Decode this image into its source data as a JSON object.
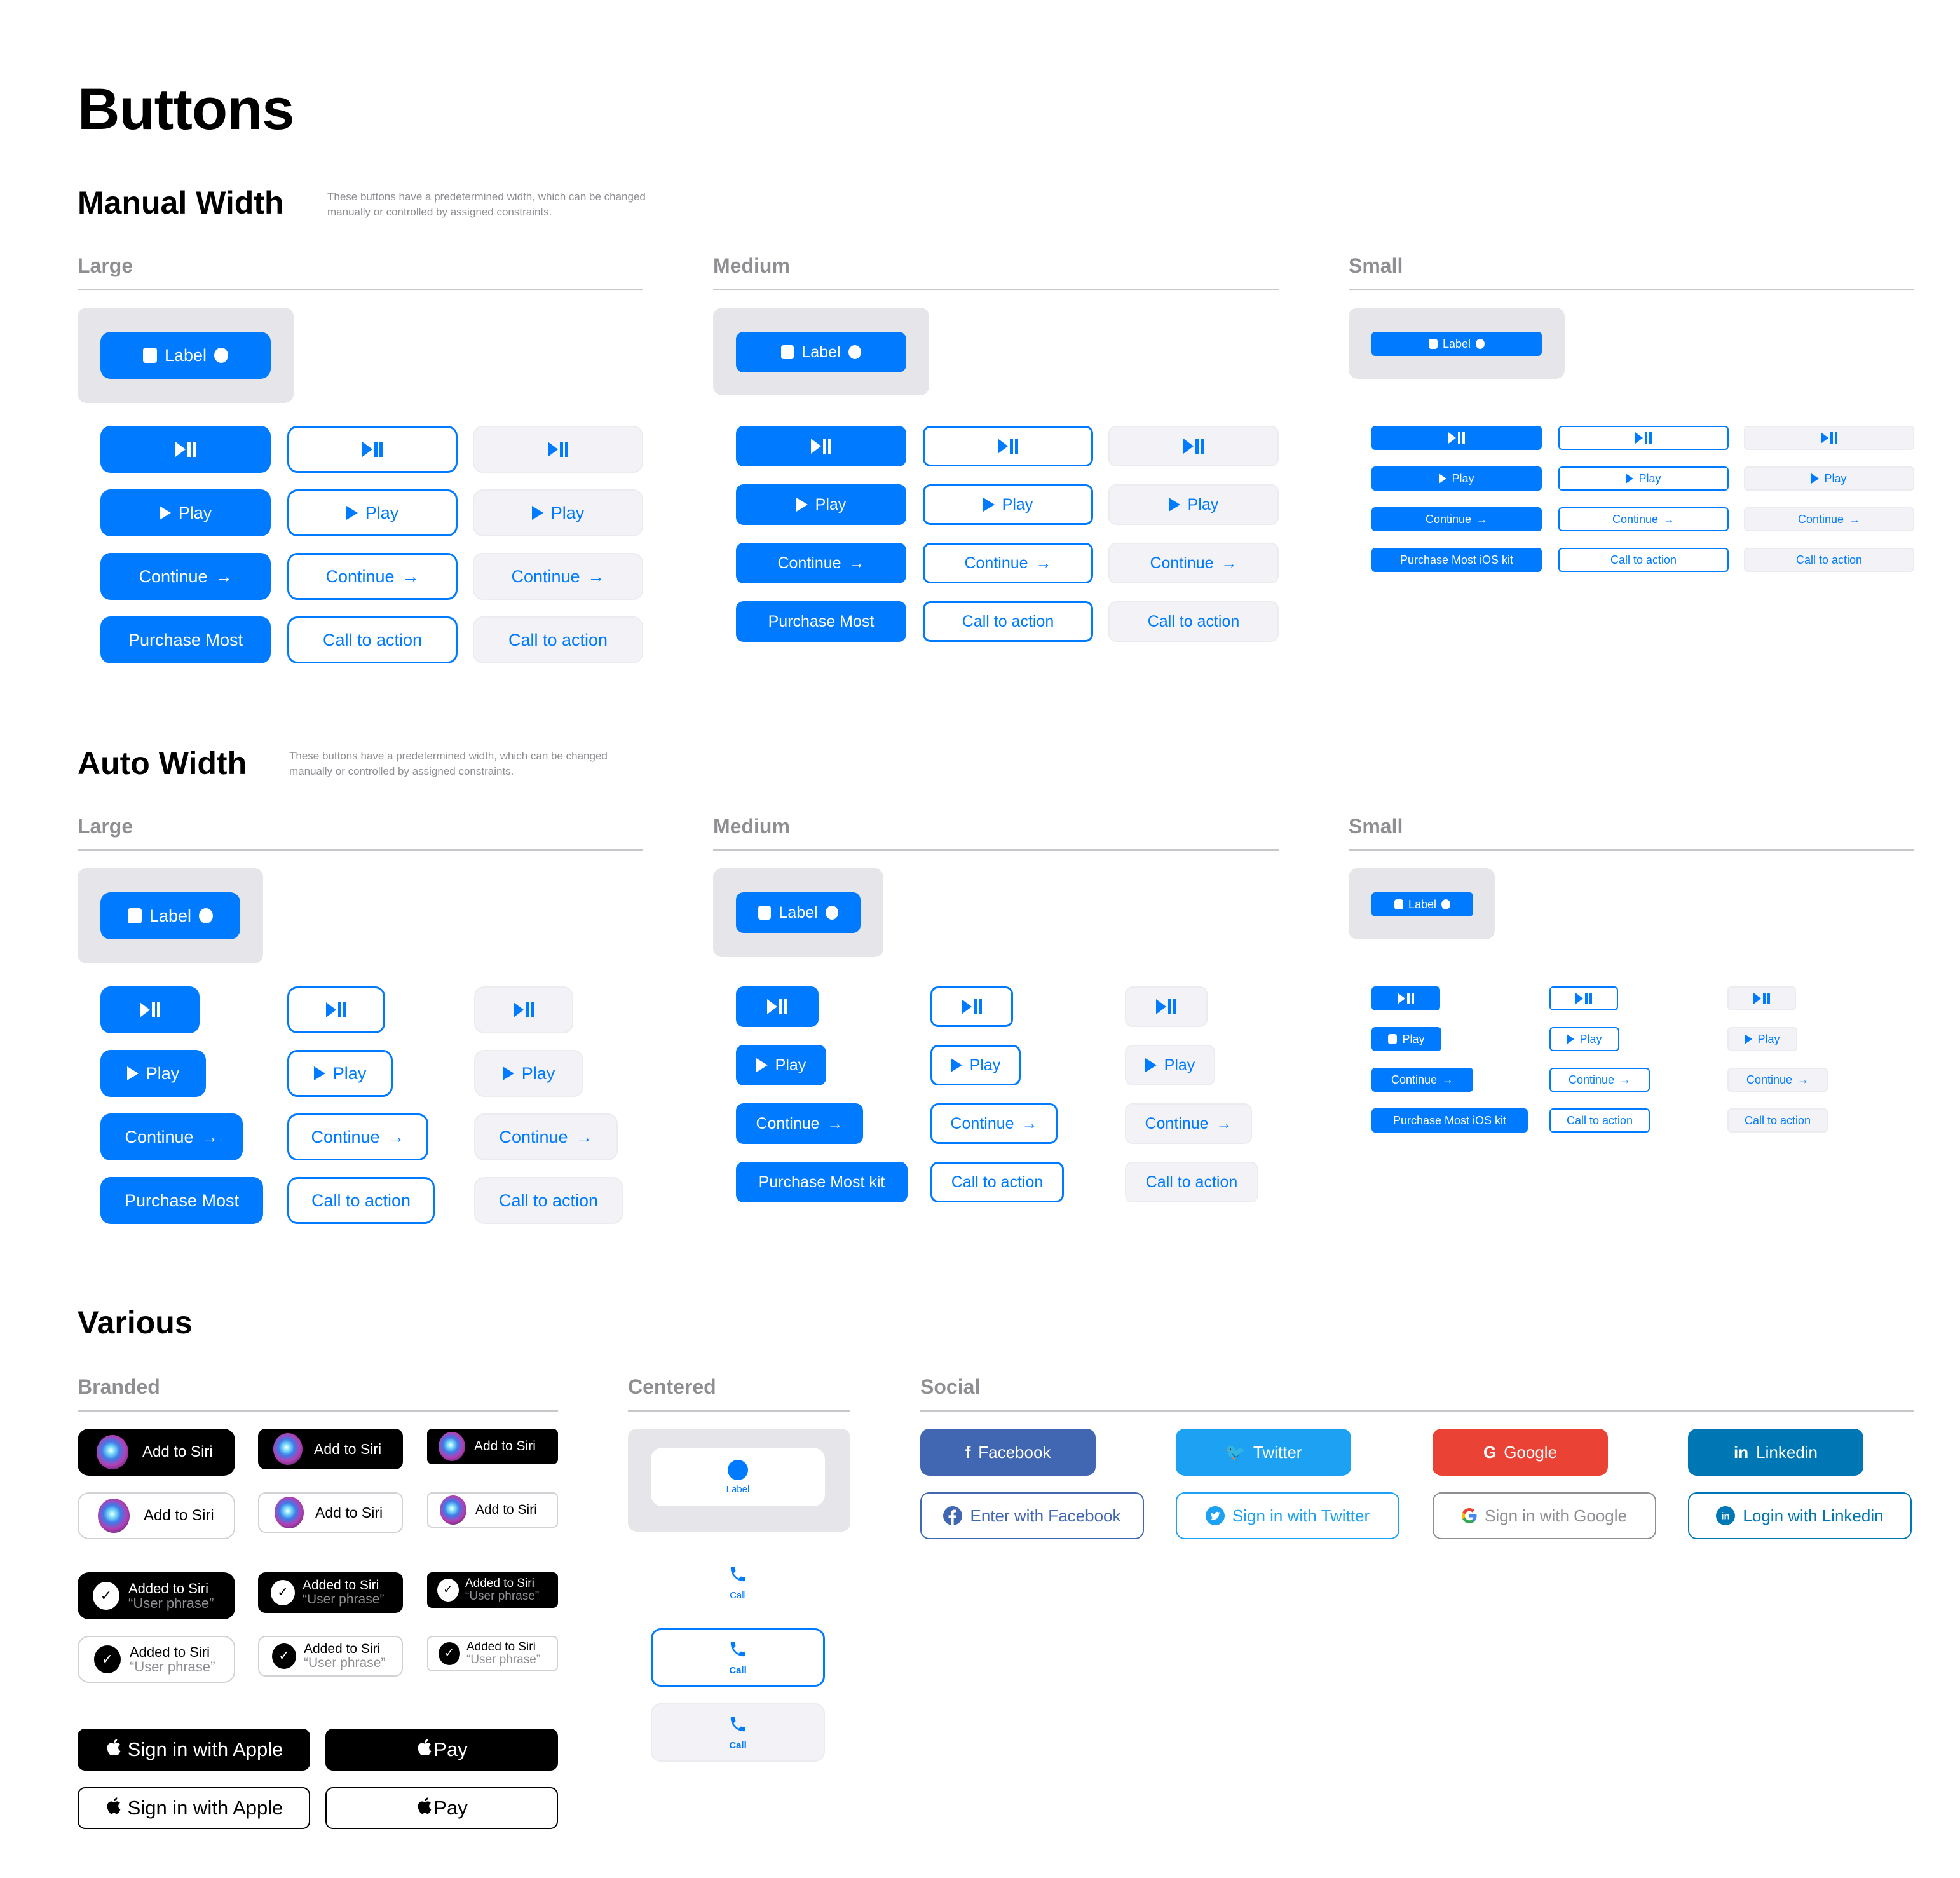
{
  "page": {
    "title": "Buttons",
    "manual": {
      "heading": "Manual Width",
      "description": "These buttons have a predetermined width, which can be changed manually or controlled by assigned constraints."
    },
    "auto": {
      "heading": "Auto Width",
      "description": "These buttons have a predetermined width, which can be changed manually or controlled by assigned constraints."
    },
    "various": {
      "heading": "Various"
    }
  },
  "sizes": {
    "large": "Large",
    "medium": "Medium",
    "small": "Small"
  },
  "common": {
    "label": "Label",
    "play": "Play",
    "continue": "Continue",
    "arrow": "→",
    "cta": "Call to action"
  },
  "purchase": {
    "manual_large": "Purchase Most",
    "manual_medium": "Purchase Most",
    "manual_small": "Purchase Most iOS kit",
    "auto_large": "Purchase Most",
    "auto_medium": "Purchase Most kit",
    "auto_small": "Purchase Most iOS kit"
  },
  "variants": [
    "filled",
    "outlined",
    "tinted"
  ],
  "branded": {
    "heading": "Branded",
    "add_to_siri": "Add to Siri",
    "added_to_siri": "Added to Siri",
    "user_phrase": "“User phrase”",
    "sign_in_apple": "Sign in with Apple",
    "apple_pay": "Pay"
  },
  "centered": {
    "heading": "Centered",
    "label": "Label",
    "call": "Call"
  },
  "social": {
    "heading": "Social",
    "filled": [
      {
        "name": "facebook",
        "label": "Facebook",
        "icon": "f",
        "color": "#4267b2"
      },
      {
        "name": "twitter",
        "label": "Twitter",
        "icon": "🐦",
        "color": "#1da1f2"
      },
      {
        "name": "google",
        "label": "Google",
        "icon": "G",
        "color": "#ea4335"
      },
      {
        "name": "linkedin",
        "label": "Linkedin",
        "icon": "in",
        "color": "#0077b5"
      }
    ],
    "outlined": [
      {
        "name": "facebook",
        "label": "Enter with Facebook",
        "color": "#4267b2"
      },
      {
        "name": "twitter",
        "label": "Sign in with Twitter",
        "color": "#1da1f2"
      },
      {
        "name": "google",
        "label": "Sign in with Google",
        "color": "#8e8e93"
      },
      {
        "name": "linkedin",
        "label": "Login with Linkedin",
        "color": "#0077b5"
      }
    ]
  },
  "colors": {
    "accent": "#007aff",
    "tinted_bg": "#f2f2f7",
    "container_bg": "#e5e5ea",
    "secondary_text": "#8e8e93"
  }
}
